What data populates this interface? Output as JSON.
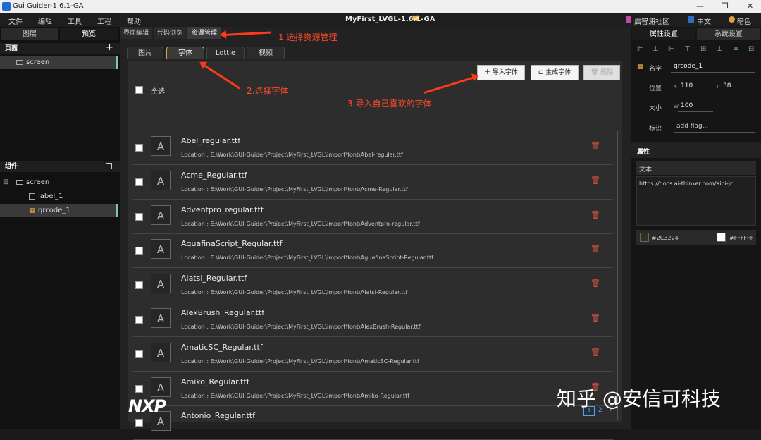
{
  "window": {
    "title": "Gui Guider-1.6.1-GA",
    "min": "—",
    "max": "❐",
    "close": "✕"
  },
  "menu": [
    "文件",
    "编辑",
    "工具",
    "工程",
    "帮助"
  ],
  "project_title": "MyFirst_LVGL-1.6.1-GA",
  "project_icon": "📂",
  "topright": {
    "community": "启智浦社区",
    "language": "中文",
    "theme": "暗色"
  },
  "left": {
    "tabs": [
      "图层",
      "预览"
    ],
    "pages_header": "页面",
    "add": "+",
    "pages": [
      "screen"
    ],
    "widgets_header": "组件",
    "tree": [
      {
        "label": "screen",
        "expander": "⊟"
      },
      {
        "label": "label_1",
        "icon": "T"
      },
      {
        "label": "qrcode_1",
        "icon": "▦"
      }
    ]
  },
  "center": {
    "tabs": [
      "界面编辑",
      "代码浏览",
      "资源管理"
    ],
    "res_tabs": [
      "图片",
      "字体",
      "Lottie",
      "视频"
    ],
    "buttons": {
      "import": "导入字体",
      "generate": "生成字体",
      "delete": "删除"
    },
    "select_all": "全选",
    "fonts": [
      {
        "name": "Abel_regular.ttf",
        "location": "Location : E:\\Work\\GUI-Guider\\Project\\MyFirst_LVGL\\import\\font\\Abel-regular.ttf",
        "preview": "A"
      },
      {
        "name": "Acme_Regular.ttf",
        "location": "Location : E:\\Work\\GUI-Guider\\Project\\MyFirst_LVGL\\import\\font\\Acme-Regular.ttf",
        "preview": "A"
      },
      {
        "name": "Adventpro_regular.ttf",
        "location": "Location : E:\\Work\\GUI-Guider\\Project\\MyFirst_LVGL\\import\\font\\Adventpro-regular.ttf",
        "preview": "A"
      },
      {
        "name": "AguafinaScript_Regular.ttf",
        "location": "Location : E:\\Work\\GUI-Guider\\Project\\MyFirst_LVGL\\import\\font\\AguafinaScript-Regular.ttf",
        "preview": "A"
      },
      {
        "name": "Alatsi_Regular.ttf",
        "location": "Location : E:\\Work\\GUI-Guider\\Project\\MyFirst_LVGL\\import\\font\\Alatsi-Regular.ttf",
        "preview": "A"
      },
      {
        "name": "AlexBrush_Regular.ttf",
        "location": "Location : E:\\Work\\GUI-Guider\\Project\\MyFirst_LVGL\\import\\font\\AlexBrush-Regular.ttf",
        "preview": "A"
      },
      {
        "name": "AmaticSC_Regular.ttf",
        "location": "Location : E:\\Work\\GUI-Guider\\Project\\MyFirst_LVGL\\import\\font\\AmaticSC-Regular.ttf",
        "preview": "A"
      },
      {
        "name": "Amiko_Regular.ttf",
        "location": "Location : E:\\Work\\GUI-Guider\\Project\\MyFirst_LVGL\\import\\font\\Amiko-Regular.ttf",
        "preview": "A"
      },
      {
        "name": "Antonio_Regular.ttf",
        "location": "",
        "preview": "A"
      }
    ],
    "pagination": [
      "1",
      "2",
      "›"
    ]
  },
  "right": {
    "tabs": [
      "属性设置",
      "系统设置"
    ],
    "name_label": "名字",
    "name_value": "qrcode_1",
    "pos_label": "位置",
    "x_label": "X",
    "x": "110",
    "y_label": "Y",
    "y": "38",
    "size_label": "大小",
    "w_label": "W",
    "w": "100",
    "flag_label": "标识",
    "flag_value": "add flag...",
    "props_header": "属性",
    "text_label": "文本",
    "text_value": "https://docs.ai-thinker.com/aipi-jc",
    "color1": "#2C3224",
    "color2": "#FFFFFF"
  },
  "annotations": {
    "a1": "1.选择资源管理",
    "a2": "2.选择字体",
    "a3": "3.导入自己喜欢的字体"
  },
  "watermark": {
    "nxp": "NXP",
    "zhihu": "知乎 @安信可科技"
  }
}
